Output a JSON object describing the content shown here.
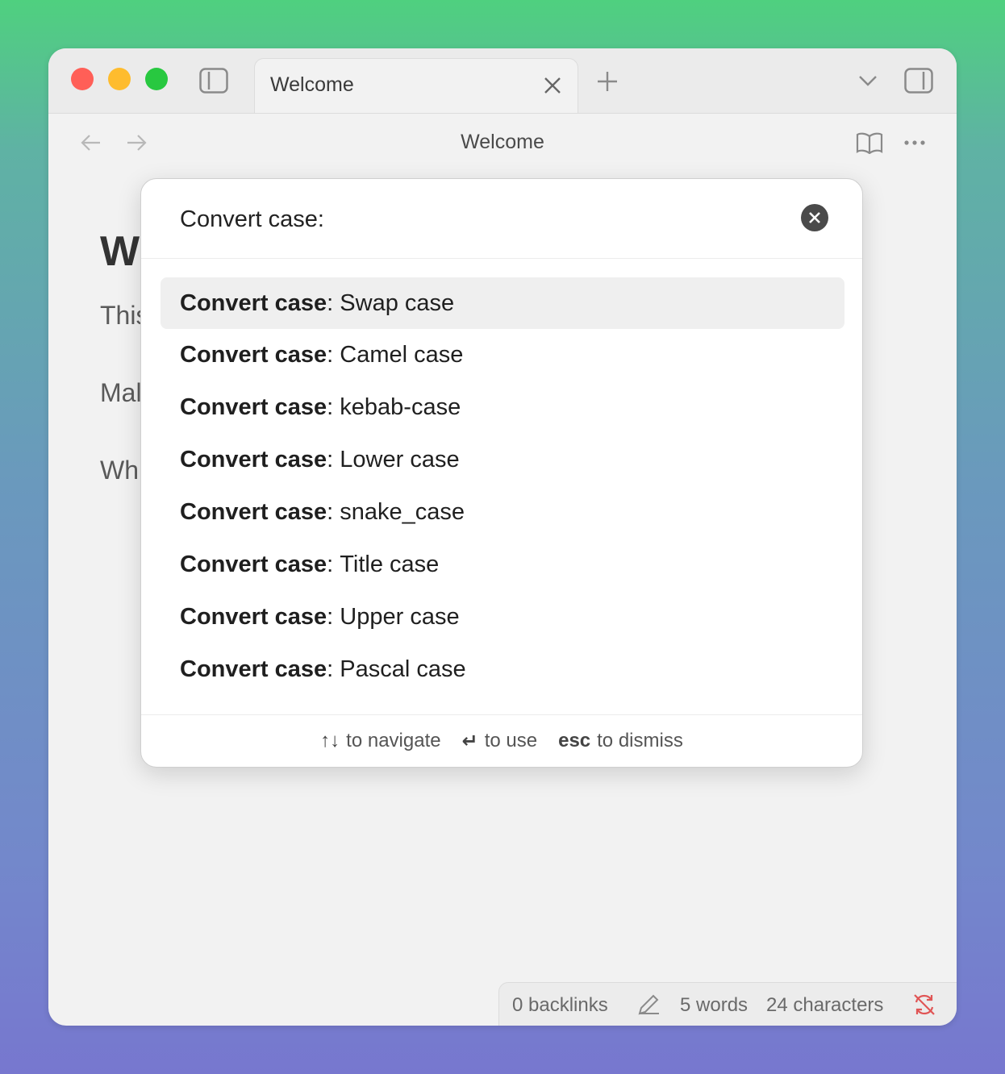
{
  "colors": {
    "close": "#ff5f57",
    "minimize": "#febc2e",
    "zoom": "#28c840",
    "sync_error": "#e05555"
  },
  "tabbar": {
    "tab_title": "Welcome",
    "icons": [
      "sidebar-left-icon",
      "close-icon",
      "plus-icon",
      "chevron-down-icon",
      "sidebar-right-icon"
    ]
  },
  "navbar": {
    "title": "Welcome",
    "icons": [
      "arrow-left-icon",
      "arrow-right-icon",
      "book-icon",
      "more-icon"
    ]
  },
  "doc": {
    "heading_fragment": "W",
    "line1_fragment": "This",
    "line2_fragment": "Mal",
    "line3_fragment": "Wh"
  },
  "palette": {
    "prompt": "Convert case:",
    "prefix": "Convert case",
    "items": [
      {
        "label": "Swap case",
        "selected": true
      },
      {
        "label": "Camel case",
        "selected": false
      },
      {
        "label": "kebab-case",
        "selected": false
      },
      {
        "label": "Lower case",
        "selected": false
      },
      {
        "label": "snake_case",
        "selected": false
      },
      {
        "label": "Title case",
        "selected": false
      },
      {
        "label": "Upper case",
        "selected": false
      },
      {
        "label": "Pascal case",
        "selected": false
      }
    ],
    "footer": {
      "navigate_key": "↑↓",
      "navigate_text": "to navigate",
      "use_key": "↵",
      "use_text": "to use",
      "dismiss_key": "esc",
      "dismiss_text": "to dismiss"
    }
  },
  "statusbar": {
    "backlinks": "0 backlinks",
    "words": "5 words",
    "characters": "24 characters",
    "icons": [
      "edit-pencil-icon",
      "sync-error-icon"
    ]
  }
}
